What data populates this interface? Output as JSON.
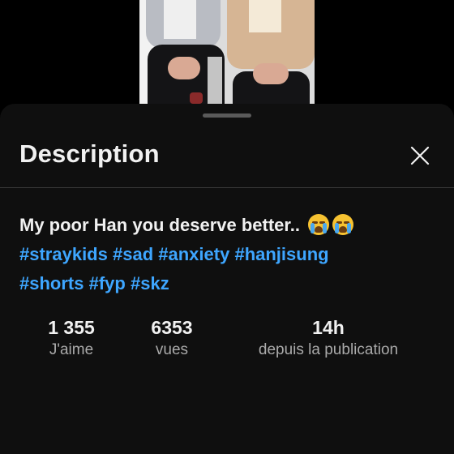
{
  "sheet": {
    "title": "Description",
    "close_icon": "close-icon"
  },
  "description": {
    "text": "My poor Han you deserve better..",
    "emojis": [
      "loudly-crying-face-emoji",
      "loudly-crying-face-emoji"
    ],
    "hashtags_line1": [
      "#straykids",
      "#sad",
      "#anxiety",
      "#hanjisung"
    ],
    "hashtags_line2": [
      "#shorts",
      "#fyp",
      "#skz"
    ]
  },
  "stats": {
    "likes": {
      "value": "1 355",
      "label": "J'aime"
    },
    "views": {
      "value": "6353",
      "label": "vues"
    },
    "age": {
      "value": "14h",
      "label": "depuis la publication"
    }
  },
  "colors": {
    "sheet_bg": "#0f0f0f",
    "text": "#f1f1f1",
    "secondary_text": "#aaaaaa",
    "hashtag": "#3ea6ff"
  }
}
